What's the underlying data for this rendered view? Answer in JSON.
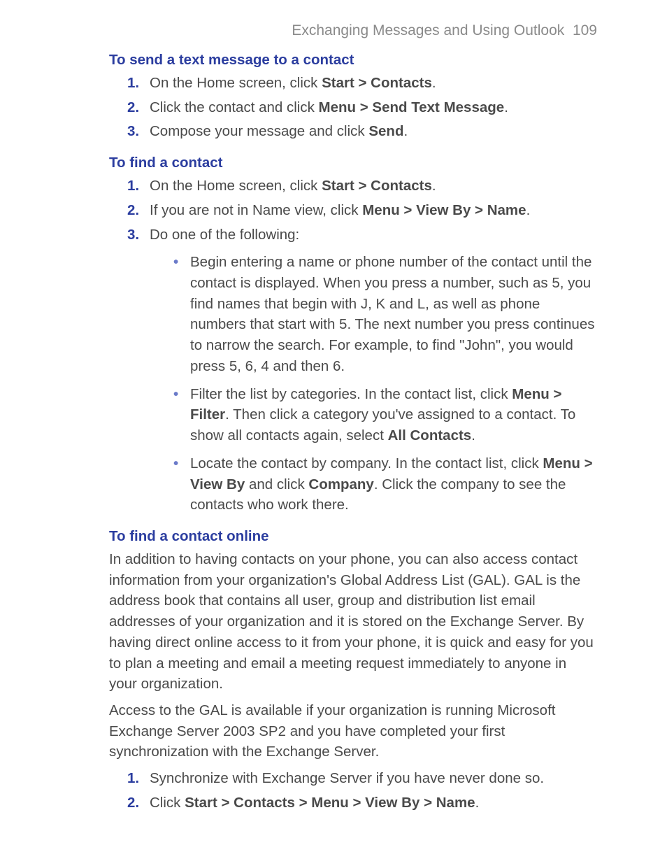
{
  "header": {
    "title": "Exchanging Messages and Using Outlook",
    "page_no": "109"
  },
  "section1": {
    "title": "To send a text message to a contact",
    "items": [
      {
        "num": "1.",
        "pre": "On the Home screen, click ",
        "bold1": "Start > Contacts",
        "post": "."
      },
      {
        "num": "2.",
        "pre": "Click the contact and click ",
        "bold1": "Menu > Send Text Message",
        "post": "."
      },
      {
        "num": "3.",
        "pre": "Compose your message and click ",
        "bold1": "Send",
        "post": "."
      }
    ]
  },
  "section2": {
    "title": "To find a contact",
    "items": [
      {
        "num": "1.",
        "pre": "On the Home screen, click ",
        "bold1": "Start > Contacts",
        "post": "."
      },
      {
        "num": "2.",
        "pre": "If you are not in Name view, click ",
        "bold1": "Menu > View By > Name",
        "post": "."
      },
      {
        "num": "3.",
        "pre": "Do one of the following:",
        "bold1": "",
        "post": ""
      }
    ],
    "bullets": [
      {
        "text": "Begin entering a name or phone number of the contact until the contact is displayed. When you press a number, such as 5, you find names that begin with J, K and L, as well as phone numbers that start with 5. The next number you press continues to narrow the search. For example, to find \"John\", you would press 5, 6, 4 and then 6."
      },
      {
        "seg1": "Filter the list by categories. In the contact list, click ",
        "b1": "Menu > Filter",
        "seg2": ". Then click a category you've assigned to a contact. To show all contacts again, select ",
        "b2": "All Contacts",
        "seg3": "."
      },
      {
        "seg1": "Locate the contact by company. In the contact list, click ",
        "b1": "Menu > View By",
        "seg2": " and click ",
        "b2": "Company",
        "seg3": ". Click the company to see the contacts who work there."
      }
    ]
  },
  "section3": {
    "title": "To find a contact online",
    "para1": "In addition to having contacts on your phone, you can also access contact information from your organization's Global Address List (GAL). GAL is the address book that contains all user, group and distribution list email addresses of your organization and it is stored on the Exchange Server. By having direct online access to it from your phone, it is quick and easy for you to plan a meeting and email a meeting request immediately to anyone in your organization.",
    "para2": "Access to the GAL is available if your organization is running Microsoft Exchange Server 2003 SP2 and you have completed your first synchronization with the Exchange Server.",
    "items": [
      {
        "num": "1.",
        "pre": "Synchronize with Exchange Server if you have never done so.",
        "bold1": "",
        "post": ""
      },
      {
        "num": "2.",
        "pre": "Click ",
        "bold1": "Start > Contacts > Menu > View By > Name",
        "post": "."
      }
    ]
  }
}
